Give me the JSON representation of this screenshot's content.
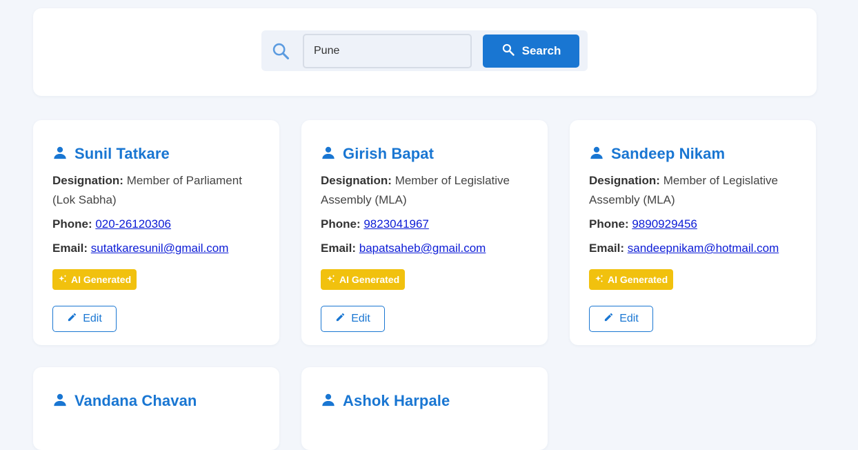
{
  "search": {
    "value": "Pune",
    "button_label": "Search"
  },
  "labels": {
    "designation": "Designation:",
    "phone": "Phone:",
    "email": "Email:",
    "badge": "AI Generated",
    "edit": "Edit"
  },
  "colors": {
    "primary": "#1976d2",
    "badge": "#f1c10e",
    "background": "#f3f6fb"
  },
  "cards": [
    {
      "name": "Sunil Tatkare",
      "designation": "Member of Parliament (Lok Sabha)",
      "phone": "020-26120306",
      "email": "sutatkaresunil@gmail.com"
    },
    {
      "name": "Girish Bapat",
      "designation": "Member of Legislative Assembly (MLA)",
      "phone": "9823041967",
      "email": "bapatsaheb@gmail.com"
    },
    {
      "name": "Sandeep Nikam",
      "designation": "Member of Legislative Assembly (MLA)",
      "phone": "9890929456",
      "email": "sandeepnikam@hotmail.com"
    },
    {
      "name": "Vandana Chavan"
    },
    {
      "name": "Ashok Harpale"
    }
  ]
}
